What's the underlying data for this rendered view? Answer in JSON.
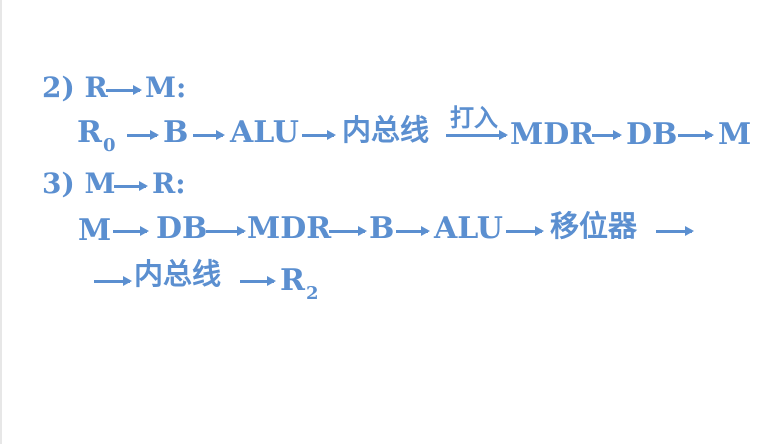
{
  "colors": {
    "text": "#5b8fd0",
    "background": "#ffffff"
  },
  "slide": {
    "h1": {
      "label": "2) R",
      "target": "M:"
    },
    "line1": {
      "r": "R",
      "r_sub": "0",
      "b": "B",
      "alu": "ALU",
      "bus": "内总线",
      "above_label": "打入",
      "mdr": "MDR",
      "db": "DB",
      "m": "M"
    },
    "h2": {
      "label": "3) M",
      "target": "R:"
    },
    "line2": {
      "m": "M",
      "db": "DB",
      "mdr": "MDR",
      "b": "B",
      "alu": "ALU",
      "shifter": "移位器"
    },
    "line3": {
      "bus": "内总线",
      "r": "R",
      "r_sub": "2"
    }
  }
}
